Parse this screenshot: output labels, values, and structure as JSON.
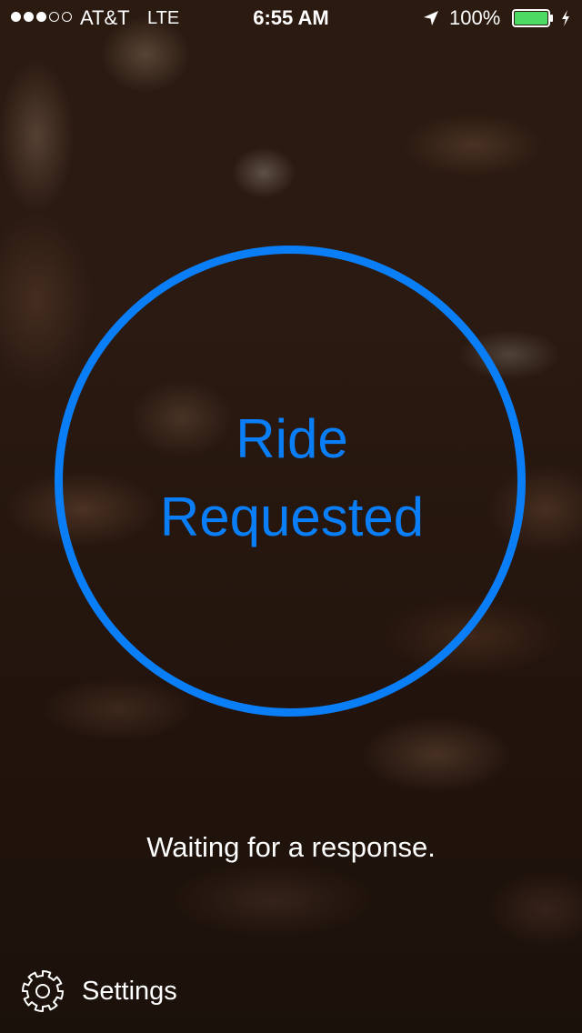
{
  "status_bar": {
    "signal_bars": [
      true,
      true,
      true,
      false,
      false
    ],
    "carrier": "AT&T",
    "network": "LTE",
    "time": "6:55 AM",
    "location_icon": "location-arrow-icon",
    "battery_percent": "100%",
    "battery_level": 1.0,
    "charging_icon": "bolt-icon"
  },
  "ride": {
    "status_text": "Ride\nRequested",
    "message": "Waiting for a response."
  },
  "settings": {
    "icon": "gear-icon",
    "label": "Settings"
  },
  "colors": {
    "accent": "#0a7ef7",
    "battery": "#4cd964",
    "text": "#ffffff"
  }
}
